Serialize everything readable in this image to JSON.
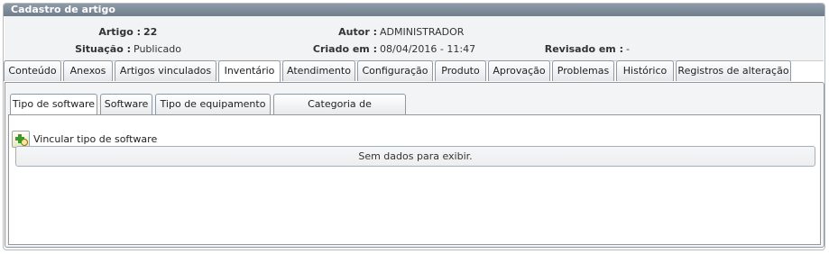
{
  "panel": {
    "title": "Cadastro de artigo"
  },
  "info": {
    "artigo_label": "Artigo :",
    "artigo_value": "22",
    "autor_label": "Autor :",
    "autor_value": "ADMINISTRADOR",
    "situacao_label": "Situação :",
    "situacao_value": "Publicado",
    "criado_label": "Criado em :",
    "criado_value": "08/04/2016 - 11:47",
    "revisado_label": "Revisado em :",
    "revisado_value": "-"
  },
  "tabs": [
    {
      "label": "Conteúdo"
    },
    {
      "label": "Anexos"
    },
    {
      "label": "Artigos vinculados"
    },
    {
      "label": "Inventário",
      "active": true
    },
    {
      "label": "Atendimento"
    },
    {
      "label": "Configuração"
    },
    {
      "label": "Produto"
    },
    {
      "label": "Aprovação"
    },
    {
      "label": "Problemas"
    },
    {
      "label": "Histórico"
    },
    {
      "label": "Registros de alteração"
    }
  ],
  "subtabs": [
    {
      "label": "Tipo de software",
      "active": true
    },
    {
      "label": "Software"
    },
    {
      "label": "Tipo de equipamento"
    },
    {
      "label": "Categoria de equipamento"
    }
  ],
  "content": {
    "add_icon": "add-magnifier-icon",
    "link_label": "Vincular tipo de software",
    "empty_message": "Sem dados para exibir."
  }
}
